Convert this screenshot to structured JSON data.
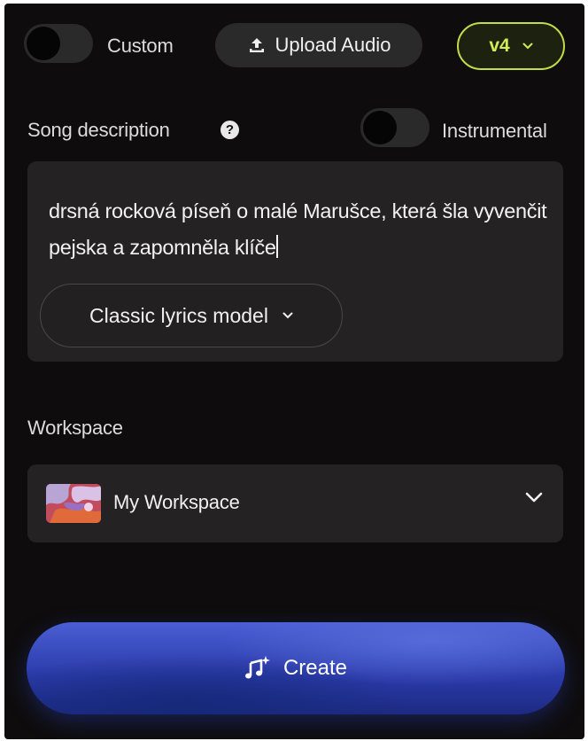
{
  "top_bar": {
    "custom_label": "Custom",
    "upload_label": "Upload Audio",
    "version_label": "v4"
  },
  "description": {
    "label": "Song description",
    "help_symbol": "?",
    "instrumental_label": "Instrumental",
    "text": "drsná rocková píseň o malé Marušce, která šla vyvenčit pejska a zapomněla klíče",
    "lyrics_model_label": "Classic lyrics model"
  },
  "workspace": {
    "label": "Workspace",
    "selected": "My Workspace"
  },
  "create": {
    "label": "Create"
  },
  "colors": {
    "background": "#0e0c0c",
    "panel": "#242222",
    "version_accent": "#c3dc4a",
    "create_blue": "#3a4cc4"
  }
}
